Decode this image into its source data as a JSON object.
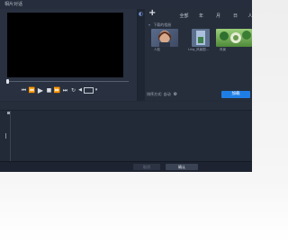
{
  "window": {
    "title": "相片对话"
  },
  "media": {
    "tabs": [
      {
        "label": "全部"
      },
      {
        "label": "年"
      },
      {
        "label": "月"
      },
      {
        "label": "日"
      },
      {
        "label": "人物"
      }
    ],
    "folder_label": "下载的相册",
    "items": [
      {
        "name": "人脸"
      },
      {
        "name": "Ling_风景图..."
      },
      {
        "name": "风景"
      }
    ],
    "sort_label": "排序方式: 自动",
    "add_button": "加载"
  },
  "footer": {
    "cancel_label": "取消",
    "ok_label": "确认"
  },
  "colors": {
    "accent": "#1f7ee6",
    "window_bg": "#232a38",
    "preview_bg": "#000000"
  }
}
